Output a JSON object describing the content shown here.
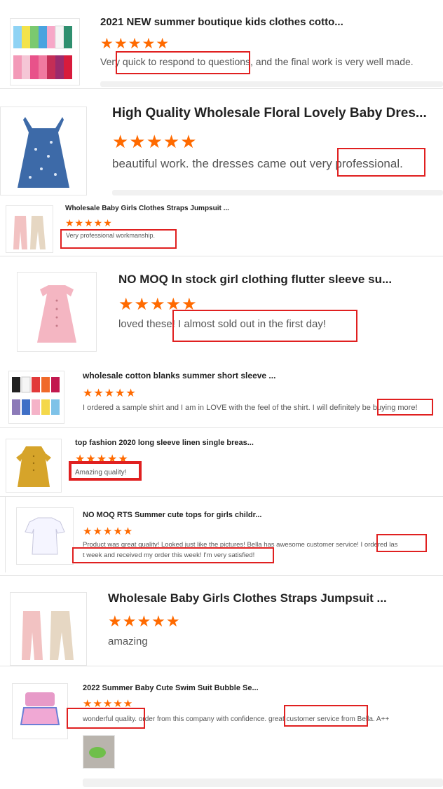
{
  "accent_color": "#ff6a00",
  "highlight_color": "#e02020",
  "reviews": [
    {
      "title": "2021 NEW summer boutique kids clothes cotto...",
      "stars": "★★★★★",
      "text": "Very quick to respond to questions, and the final work is very well made."
    },
    {
      "title": "High Quality Wholesale Floral Lovely Baby Dres...",
      "stars": "★★★★★",
      "text": "beautiful work. the dresses came out very professional."
    },
    {
      "title": "Wholesale Baby Girls Clothes Straps Jumpsuit ...",
      "stars": "★★★★★",
      "text": "Very professional workmanship."
    },
    {
      "title": "NO MOQ In stock girl clothing flutter sleeve su...",
      "stars": "★★★★★",
      "text": "loved these! I almost sold out in the first day!"
    },
    {
      "title": "wholesale cotton blanks summer short sleeve ...",
      "stars": "★★★★★",
      "text": "I ordered a sample shirt and I am in LOVE with the feel of the shirt. I will definitely be buying more!"
    },
    {
      "title": "top fashion 2020 long sleeve linen single breas...",
      "stars": "★★★★★",
      "text": "Amazing quality!"
    },
    {
      "title": "NO MOQ RTS Summer cute tops for girls childr...",
      "stars": "★★★★★",
      "text_line1": "Product was great quality! Looked just like the pictures! Bella has awesome customer service! I ordered las",
      "text_line2": "t week and received my order this week! I'm very satisfied!"
    },
    {
      "title": "Wholesale Baby Girls Clothes Straps Jumpsuit ...",
      "stars": "★★★★★",
      "text": "amazing"
    },
    {
      "title": "2022 Summer Baby Cute Swim Suit Bubble Se...",
      "stars": "★★★★★",
      "text": "wonderful quality. order from this company with confidence. great customer service from Bella. A++"
    }
  ]
}
